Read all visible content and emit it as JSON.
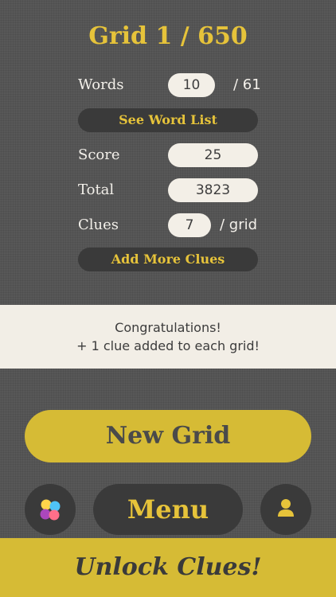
{
  "header": {
    "title": "Grid 1 / 650"
  },
  "stats": {
    "words_label": "Words",
    "words_value": "10",
    "words_total": "/ 61",
    "see_word_list": "See Word List",
    "score_label": "Score",
    "score_value": "25",
    "total_label": "Total",
    "total_value": "3823",
    "clues_label": "Clues",
    "clues_value": "7",
    "clues_suffix": "/ grid",
    "add_more_clues": "Add More Clues"
  },
  "banner": {
    "line1": "Congratulations!",
    "line2": "+ 1 clue added to each grid!"
  },
  "actions": {
    "new_grid": "New Grid",
    "menu": "Menu",
    "left_icon": "game-center-icon",
    "right_icon": "profile-icon",
    "unlock": "Unlock Clues!"
  },
  "colors": {
    "accent": "#e6c33a",
    "button_yellow": "#d6bb35",
    "dark_button": "#3a3a3a",
    "cream": "#f3efe7"
  }
}
